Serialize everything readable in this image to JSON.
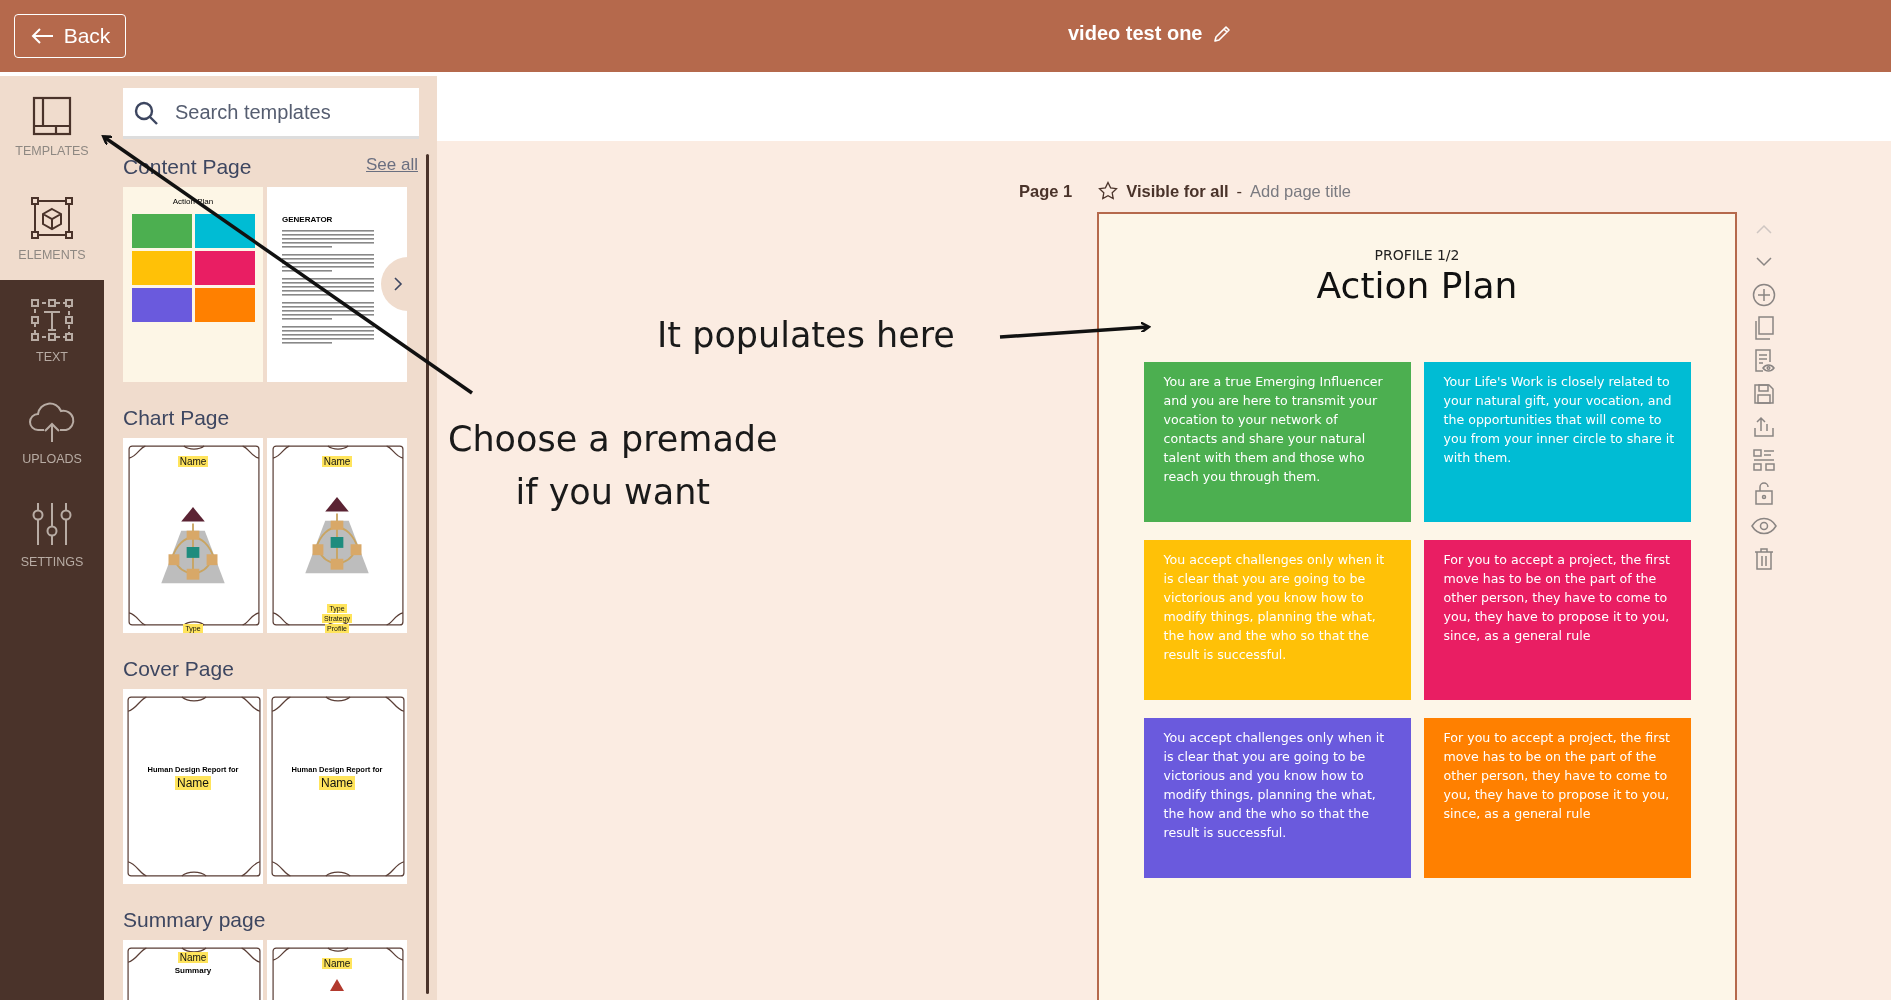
{
  "header": {
    "back_label": "Back",
    "title": "video test one"
  },
  "rail": [
    {
      "label": "TEMPLATES",
      "highlighted": true
    },
    {
      "label": "ELEMENTS",
      "highlighted": true
    },
    {
      "label": "TEXT",
      "highlighted": false
    },
    {
      "label": "UPLOADS",
      "highlighted": false
    },
    {
      "label": "SETTINGS",
      "highlighted": false
    }
  ],
  "search": {
    "placeholder": "Search templates"
  },
  "sections": [
    {
      "title": "Content Page",
      "link": "See all",
      "thumbnails": [
        {
          "kind": "blocks",
          "title": "Action Plan",
          "blocks": [
            {
              "color": "#4caf50"
            },
            {
              "color": "#00bcd4"
            },
            {
              "color": "#ffc107"
            },
            {
              "color": "#e91e63"
            },
            {
              "color": "#6a5add"
            },
            {
              "color": "#ff8000"
            }
          ]
        },
        {
          "kind": "article",
          "title": "GENERATOR"
        }
      ]
    },
    {
      "title": "Chart Page",
      "thumbnails": [
        {
          "kind": "chart",
          "name": "Name",
          "labels": [
            "Type"
          ]
        },
        {
          "kind": "chart",
          "name": "Name",
          "labels": [
            "Type",
            "Strategy",
            "Profile"
          ]
        }
      ]
    },
    {
      "title": "Cover Page",
      "thumbnails": [
        {
          "kind": "cover",
          "heading": "Human Design Report for",
          "name": "Name"
        },
        {
          "kind": "cover",
          "heading": "Human Design Report for",
          "name": "Name"
        }
      ]
    },
    {
      "title": "Summary page",
      "thumbnails": [
        {
          "kind": "summary",
          "name": "Name",
          "heading": "Summary"
        },
        {
          "kind": "chart",
          "name": "Name"
        }
      ]
    }
  ],
  "page": {
    "label": "Page 1",
    "visibility": "Visible for all",
    "separator": "-",
    "title_placeholder": "Add page title",
    "subtitle": "PROFILE 1/2",
    "title": "Action Plan",
    "cards": [
      {
        "text": "You are a true Emerging Influencer and you are here to transmit your vocation to your network of contacts and share your natural talent with them and those who reach you through them.",
        "color": "#4caf50"
      },
      {
        "text": "Your Life's Work is closely related to your natural gift, your vocation, and the opportunities that will come to you from your inner circle to share it with them.",
        "color": "#00bcd4"
      },
      {
        "text": "You accept challenges only when it is clear that you are going to be victorious and you know how to modify things, planning the what, the how and the who so that the result is successful.",
        "color": "#ffc107"
      },
      {
        "text": "For you to accept a project, the first move has to be on the part of the other person, they have to come to you, they have to propose it to you, since, as a general rule",
        "color": "#e91e63"
      },
      {
        "text": "You accept challenges only when it is clear that you are going to be victorious and you know how to modify things, planning the what, the how and the who so that the result is successful.",
        "color": "#6a5add"
      },
      {
        "text": "For you to accept a project, the first move has to be on the part of the other person, they have to come to you, they have to propose it to you, since, as a general rule",
        "color": "#ff8000"
      }
    ]
  },
  "toolbar": [
    {
      "disabled": true
    },
    {
      "disabled": false
    },
    {
      "disabled": false
    },
    {
      "disabled": false
    },
    {
      "disabled": false
    },
    {
      "disabled": false
    },
    {
      "disabled": false
    },
    {
      "disabled": false
    },
    {
      "disabled": false
    },
    {
      "disabled": false
    },
    {
      "disabled": false
    }
  ],
  "annotations": [
    {
      "kind": "right",
      "lines": [
        "It populates here"
      ]
    },
    {
      "kind": "left",
      "lines": [
        "Choose a premade",
        "if you want"
      ]
    }
  ]
}
